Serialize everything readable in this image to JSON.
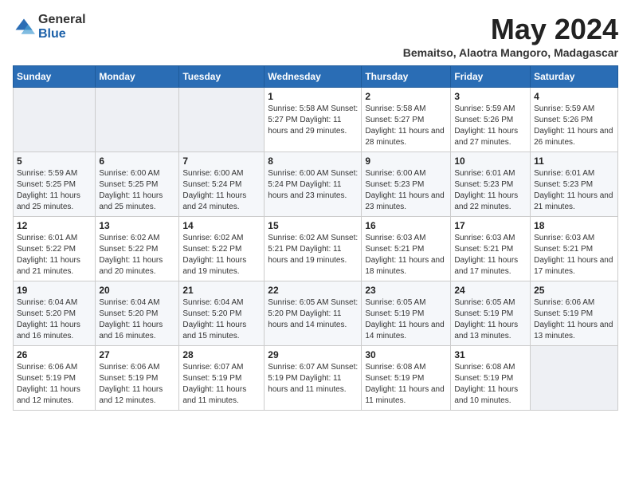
{
  "header": {
    "logo_general": "General",
    "logo_blue": "Blue",
    "month": "May 2024",
    "location": "Bemaitso, Alaotra Mangoro, Madagascar"
  },
  "weekdays": [
    "Sunday",
    "Monday",
    "Tuesday",
    "Wednesday",
    "Thursday",
    "Friday",
    "Saturday"
  ],
  "weeks": [
    [
      {
        "day": "",
        "info": ""
      },
      {
        "day": "",
        "info": ""
      },
      {
        "day": "",
        "info": ""
      },
      {
        "day": "1",
        "info": "Sunrise: 5:58 AM\nSunset: 5:27 PM\nDaylight: 11 hours\nand 29 minutes."
      },
      {
        "day": "2",
        "info": "Sunrise: 5:58 AM\nSunset: 5:27 PM\nDaylight: 11 hours\nand 28 minutes."
      },
      {
        "day": "3",
        "info": "Sunrise: 5:59 AM\nSunset: 5:26 PM\nDaylight: 11 hours\nand 27 minutes."
      },
      {
        "day": "4",
        "info": "Sunrise: 5:59 AM\nSunset: 5:26 PM\nDaylight: 11 hours\nand 26 minutes."
      }
    ],
    [
      {
        "day": "5",
        "info": "Sunrise: 5:59 AM\nSunset: 5:25 PM\nDaylight: 11 hours\nand 25 minutes."
      },
      {
        "day": "6",
        "info": "Sunrise: 6:00 AM\nSunset: 5:25 PM\nDaylight: 11 hours\nand 25 minutes."
      },
      {
        "day": "7",
        "info": "Sunrise: 6:00 AM\nSunset: 5:24 PM\nDaylight: 11 hours\nand 24 minutes."
      },
      {
        "day": "8",
        "info": "Sunrise: 6:00 AM\nSunset: 5:24 PM\nDaylight: 11 hours\nand 23 minutes."
      },
      {
        "day": "9",
        "info": "Sunrise: 6:00 AM\nSunset: 5:23 PM\nDaylight: 11 hours\nand 23 minutes."
      },
      {
        "day": "10",
        "info": "Sunrise: 6:01 AM\nSunset: 5:23 PM\nDaylight: 11 hours\nand 22 minutes."
      },
      {
        "day": "11",
        "info": "Sunrise: 6:01 AM\nSunset: 5:23 PM\nDaylight: 11 hours\nand 21 minutes."
      }
    ],
    [
      {
        "day": "12",
        "info": "Sunrise: 6:01 AM\nSunset: 5:22 PM\nDaylight: 11 hours\nand 21 minutes."
      },
      {
        "day": "13",
        "info": "Sunrise: 6:02 AM\nSunset: 5:22 PM\nDaylight: 11 hours\nand 20 minutes."
      },
      {
        "day": "14",
        "info": "Sunrise: 6:02 AM\nSunset: 5:22 PM\nDaylight: 11 hours\nand 19 minutes."
      },
      {
        "day": "15",
        "info": "Sunrise: 6:02 AM\nSunset: 5:21 PM\nDaylight: 11 hours\nand 19 minutes."
      },
      {
        "day": "16",
        "info": "Sunrise: 6:03 AM\nSunset: 5:21 PM\nDaylight: 11 hours\nand 18 minutes."
      },
      {
        "day": "17",
        "info": "Sunrise: 6:03 AM\nSunset: 5:21 PM\nDaylight: 11 hours\nand 17 minutes."
      },
      {
        "day": "18",
        "info": "Sunrise: 6:03 AM\nSunset: 5:21 PM\nDaylight: 11 hours\nand 17 minutes."
      }
    ],
    [
      {
        "day": "19",
        "info": "Sunrise: 6:04 AM\nSunset: 5:20 PM\nDaylight: 11 hours\nand 16 minutes."
      },
      {
        "day": "20",
        "info": "Sunrise: 6:04 AM\nSunset: 5:20 PM\nDaylight: 11 hours\nand 16 minutes."
      },
      {
        "day": "21",
        "info": "Sunrise: 6:04 AM\nSunset: 5:20 PM\nDaylight: 11 hours\nand 15 minutes."
      },
      {
        "day": "22",
        "info": "Sunrise: 6:05 AM\nSunset: 5:20 PM\nDaylight: 11 hours\nand 14 minutes."
      },
      {
        "day": "23",
        "info": "Sunrise: 6:05 AM\nSunset: 5:19 PM\nDaylight: 11 hours\nand 14 minutes."
      },
      {
        "day": "24",
        "info": "Sunrise: 6:05 AM\nSunset: 5:19 PM\nDaylight: 11 hours\nand 13 minutes."
      },
      {
        "day": "25",
        "info": "Sunrise: 6:06 AM\nSunset: 5:19 PM\nDaylight: 11 hours\nand 13 minutes."
      }
    ],
    [
      {
        "day": "26",
        "info": "Sunrise: 6:06 AM\nSunset: 5:19 PM\nDaylight: 11 hours\nand 12 minutes."
      },
      {
        "day": "27",
        "info": "Sunrise: 6:06 AM\nSunset: 5:19 PM\nDaylight: 11 hours\nand 12 minutes."
      },
      {
        "day": "28",
        "info": "Sunrise: 6:07 AM\nSunset: 5:19 PM\nDaylight: 11 hours\nand 11 minutes."
      },
      {
        "day": "29",
        "info": "Sunrise: 6:07 AM\nSunset: 5:19 PM\nDaylight: 11 hours\nand 11 minutes."
      },
      {
        "day": "30",
        "info": "Sunrise: 6:08 AM\nSunset: 5:19 PM\nDaylight: 11 hours\nand 11 minutes."
      },
      {
        "day": "31",
        "info": "Sunrise: 6:08 AM\nSunset: 5:19 PM\nDaylight: 11 hours\nand 10 minutes."
      },
      {
        "day": "",
        "info": ""
      }
    ]
  ]
}
